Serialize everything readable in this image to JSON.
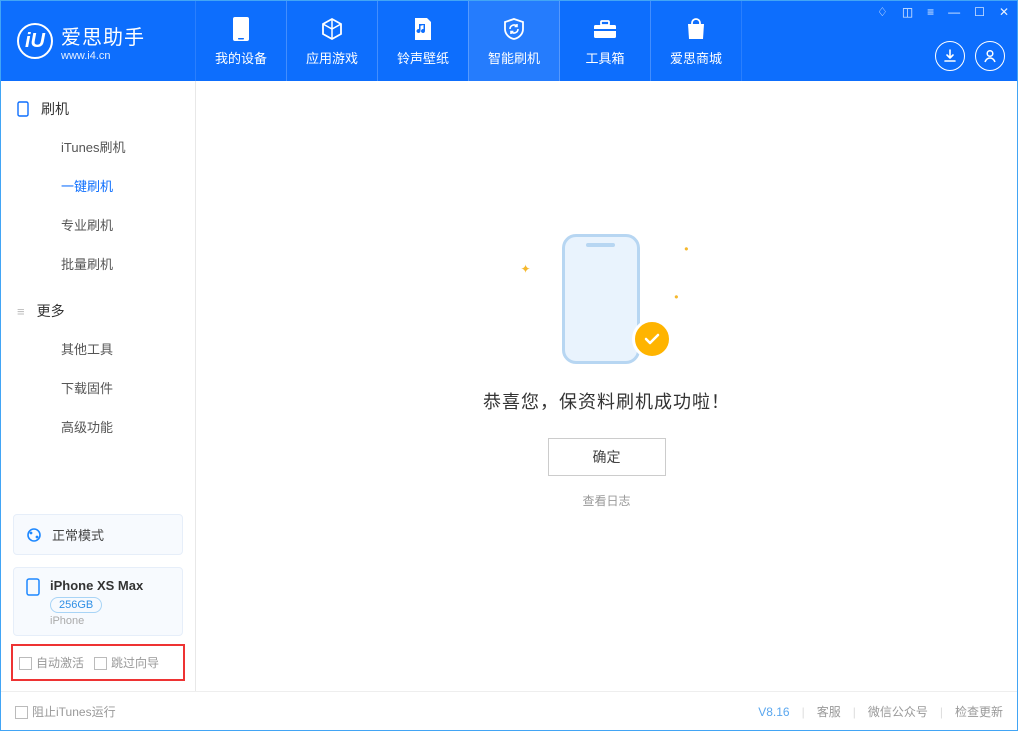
{
  "app": {
    "name": "爱思助手",
    "site": "www.i4.cn",
    "logo_letter": "iU"
  },
  "nav": {
    "tabs": [
      {
        "label": "我的设备"
      },
      {
        "label": "应用游戏"
      },
      {
        "label": "铃声壁纸"
      },
      {
        "label": "智能刷机"
      },
      {
        "label": "工具箱"
      },
      {
        "label": "爱思商城"
      }
    ],
    "active_index": 3
  },
  "sidebar": {
    "group1": {
      "title": "刷机"
    },
    "items1": [
      {
        "label": "iTunes刷机"
      },
      {
        "label": "一键刷机"
      },
      {
        "label": "专业刷机"
      },
      {
        "label": "批量刷机"
      }
    ],
    "active_item1": 1,
    "group2": {
      "title": "更多"
    },
    "items2": [
      {
        "label": "其他工具"
      },
      {
        "label": "下载固件"
      },
      {
        "label": "高级功能"
      }
    ],
    "mode": {
      "label": "正常模式"
    },
    "device": {
      "name": "iPhone XS Max",
      "capacity": "256GB",
      "platform": "iPhone"
    },
    "opts": {
      "auto_activate": "自动激活",
      "skip_guide": "跳过向导"
    }
  },
  "main": {
    "message": "恭喜您，保资料刷机成功啦！",
    "ok": "确定",
    "view_log": "查看日志"
  },
  "status": {
    "block_itunes": "阻止iTunes运行",
    "version": "V8.16",
    "links": [
      "客服",
      "微信公众号",
      "检查更新"
    ]
  }
}
